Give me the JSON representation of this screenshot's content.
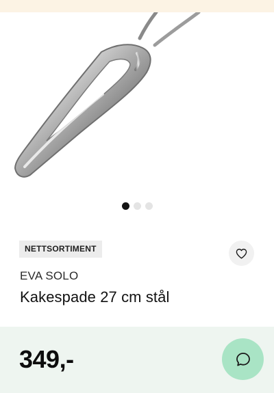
{
  "product": {
    "badge": "NETTSORTIMENT",
    "brand": "EVA SOLO",
    "title": "Kakespade 27 cm stål",
    "price": "349,-"
  },
  "carousel": {
    "total": 3,
    "active_index": 0
  },
  "icons": {
    "favorite": "heart-icon",
    "chat": "chat-bubble-icon"
  },
  "colors": {
    "top_strip": "#fcf3e4",
    "price_bar": "#eef5f0",
    "chat_button": "#a9e4c5",
    "badge_bg": "#ececec"
  }
}
